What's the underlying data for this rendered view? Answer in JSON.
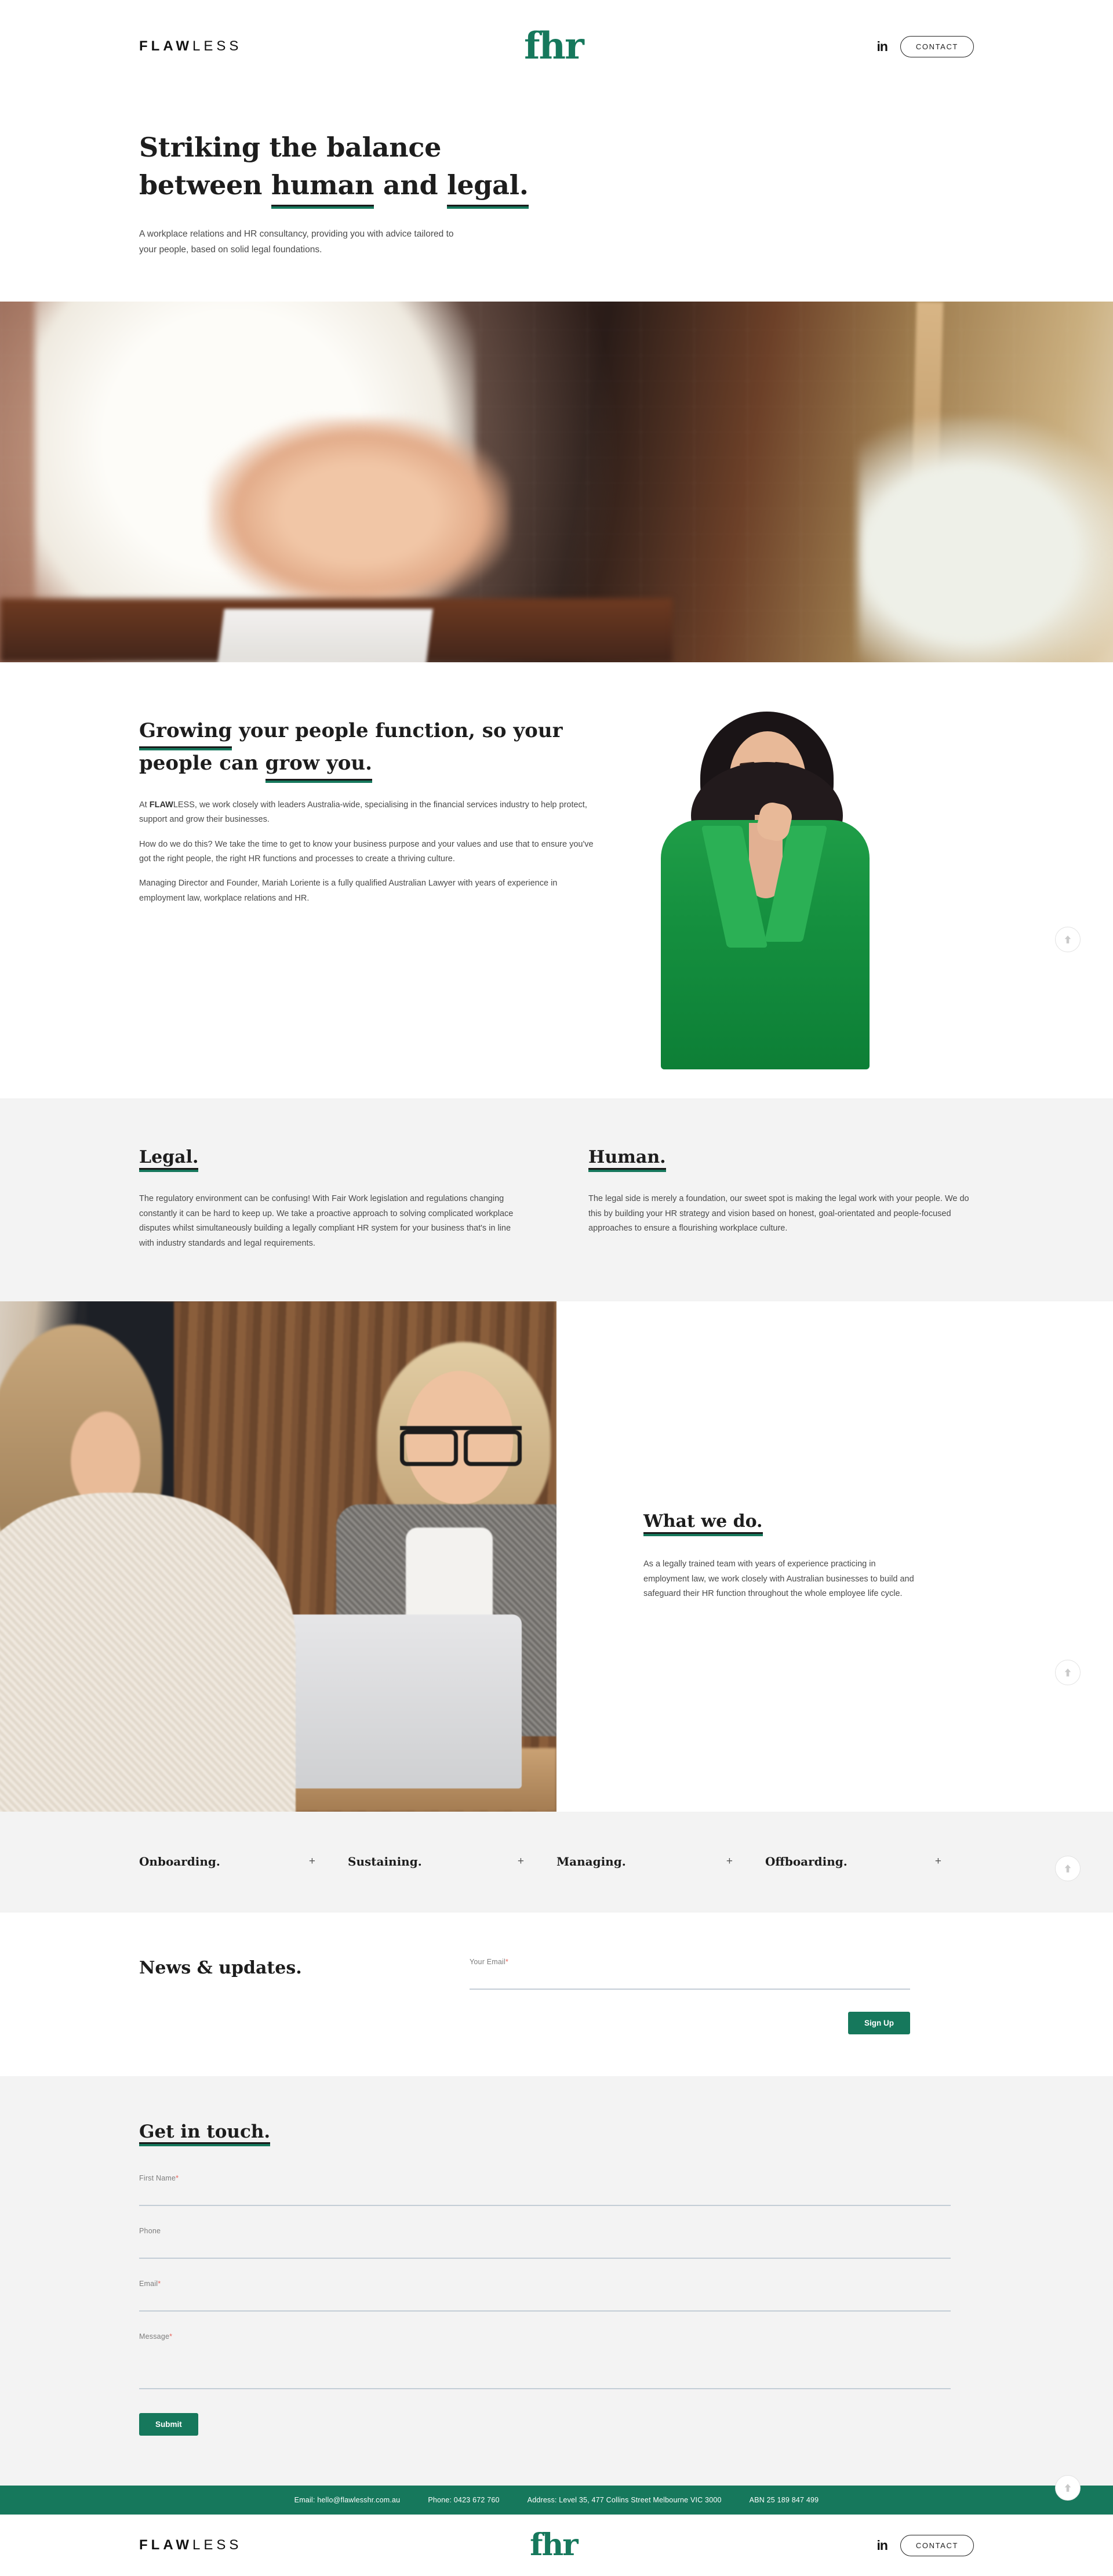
{
  "brand": {
    "word_bold": "FLAW",
    "word_light": "LESS",
    "logo": "fhr"
  },
  "header": {
    "linkedin_label": "in",
    "contact_label": "CONTACT"
  },
  "hero": {
    "line1": "Striking the balance",
    "line2_pre": "between ",
    "line2_em1": "human",
    "line2_mid": " and ",
    "line2_em2": "legal.",
    "subtitle": "A workplace relations and HR consultancy, providing you with advice tailored to your people, based on solid legal foundations."
  },
  "about": {
    "heading_em1": "Growing",
    "heading_rest": " your people function, so your people can ",
    "heading_em2": "grow you.",
    "p1_pre": "At ",
    "p1_bold": "FLAW",
    "p1_rest": "LESS, we work closely with leaders Australia-wide, specialising in the financial services industry to help protect, support and grow their businesses.",
    "p2": "How do we do this? We take the time to get to know your business purpose and your values and use that to ensure you've got the right people, the right HR functions and processes to create a thriving culture.",
    "p3": "Managing Director and Founder, Mariah Loriente is a fully qualified Australian Lawyer with years of experience in employment law, workplace relations and HR."
  },
  "pillars": [
    {
      "title": "Legal.",
      "body": "The regulatory environment can be confusing! With Fair Work legislation and regulations changing constantly it can be hard to keep up. We take a proactive approach to solving complicated workplace disputes whilst simultaneously building a legally compliant HR system for your business that's in line with industry standards and legal requirements."
    },
    {
      "title": "Human.",
      "body": "The legal side is merely a foundation, our sweet spot is making the legal work with your people. We do this by building your HR strategy and vision based on honest, goal-orientated and people-focused approaches to ensure a flourishing workplace culture."
    }
  ],
  "what_we_do": {
    "title": "What we do.",
    "body": "As a legally trained team with years of experience practicing in employment law, we work closely with Australian businesses to build and safeguard their HR function throughout the whole employee life cycle."
  },
  "accordion": {
    "plus": "+",
    "items": [
      {
        "label": "Onboarding."
      },
      {
        "label": "Sustaining."
      },
      {
        "label": "Managing."
      },
      {
        "label": "Offboarding."
      }
    ]
  },
  "news": {
    "title": "News & updates.",
    "email_label": "Your Email",
    "required_mark": "*",
    "email_value": "",
    "email_placeholder": "",
    "signup_label": "Sign Up"
  },
  "contact_form": {
    "title": "Get in touch.",
    "required_mark": "*",
    "fields": [
      {
        "label": "First Name",
        "required": true,
        "value": "",
        "placeholder": ""
      },
      {
        "label": "Phone",
        "required": false,
        "value": "",
        "placeholder": ""
      },
      {
        "label": "Email",
        "required": true,
        "value": "",
        "placeholder": ""
      },
      {
        "label": "Message",
        "required": true,
        "value": "",
        "placeholder": ""
      }
    ],
    "submit_label": "Submit"
  },
  "footer_bar": {
    "email": "Email: hello@flawlesshr.com.au",
    "phone": "Phone: 0423 672 760",
    "address": "Address: Level 35, 477 Collins Street Melbourne VIC 3000",
    "abn": "ABN 25 189 847 499"
  },
  "footer": {
    "linkedin_label": "in",
    "contact_label": "CONTACT"
  },
  "scroll_top": {
    "label": ""
  },
  "colors": {
    "accent_green": "#16785c",
    "grey_section": "#f3f3f3",
    "required_red": "#e8645a",
    "blazer_green": "#15903f"
  }
}
